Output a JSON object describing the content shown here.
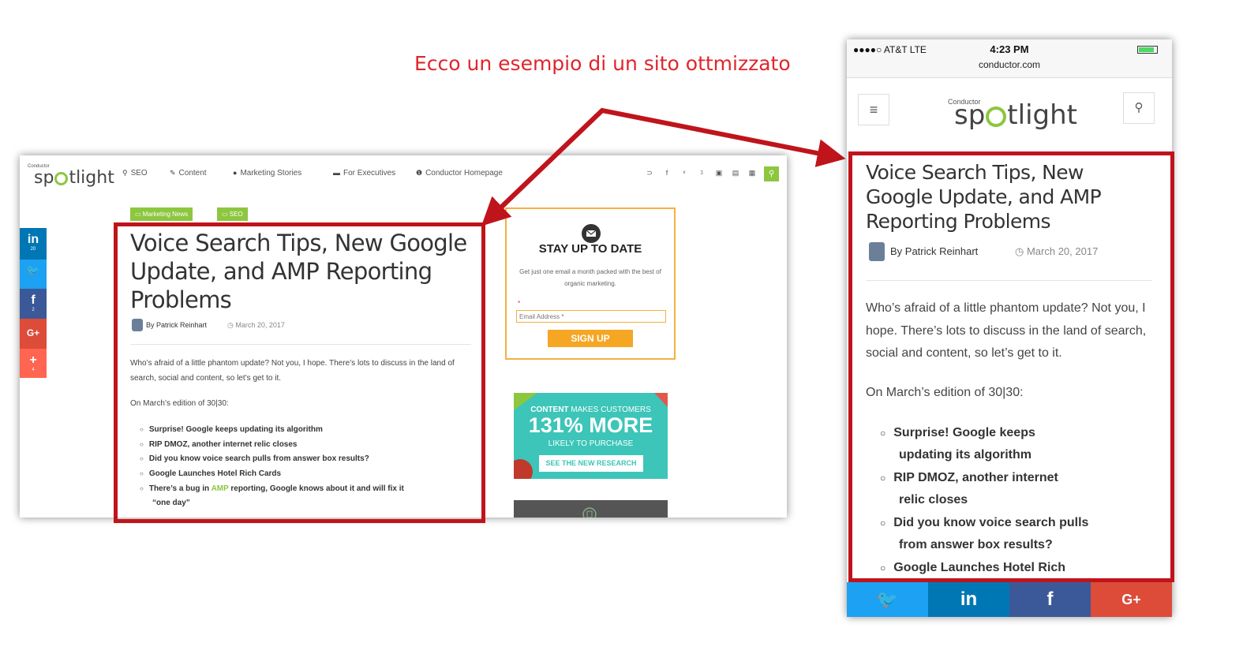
{
  "caption": "Ecco un esempio di un sito ottmizzato",
  "brand": {
    "small": "Conductor",
    "word_a": "sp",
    "word_b": "tlight"
  },
  "desktop": {
    "nav": [
      {
        "icon": "⚲",
        "label": "SEO"
      },
      {
        "icon": "✎",
        "label": "Content"
      },
      {
        "icon": "●",
        "label": "Marketing Stories"
      },
      {
        "icon": "▬",
        "label": "For Executives"
      },
      {
        "icon": "❶",
        "label": "Conductor Homepage"
      }
    ],
    "social_icons": [
      "rss-icon",
      "facebook-icon",
      "twitter-icon",
      "google-plus-icon",
      "instagram-icon",
      "youtube-icon",
      "linkedin-icon"
    ],
    "social_glyphs": [
      "⊃",
      "f",
      "ᵛ",
      "ᶾ",
      "▣",
      "▤",
      "▦"
    ],
    "search_glyph": "⚲",
    "tags": [
      "Marketing News",
      "SEO"
    ],
    "tag_icon": "▭",
    "title": "Voice Search Tips, New Google Update, and AMP Reporting Problems",
    "byline": "By Patrick Reinhart",
    "date": "March 20, 2017",
    "clock": "◷",
    "intro": "Who’s afraid of a little phantom update? Not you, I hope. There’s lots to discuss in the land of search, social and content, so let’s get to it.",
    "edition": "On March’s edition of 30|30:",
    "list": [
      "Surprise! Google keeps updating its algorithm",
      "RIP DMOZ, another internet relic closes",
      "Did you know voice search pulls from answer box results?",
      "Google Launches Hotel Rich Cards"
    ],
    "amp_item": {
      "before": "There’s a bug in ",
      "amp": "AMP",
      "after": " reporting, Google knows about it and will fix it",
      "line2": "“one day”"
    },
    "bullet": "○",
    "share": [
      {
        "glyph": "in",
        "count": "20",
        "color": "#0077b5"
      },
      {
        "glyph": "🐦",
        "count": "",
        "color": "#1da1f2"
      },
      {
        "glyph": "f",
        "count": "2",
        "color": "#3b5998"
      },
      {
        "glyph": "G+",
        "count": "",
        "color": "#dd4b39"
      },
      {
        "glyph": "+",
        "count": "4",
        "color": "#ff6550"
      }
    ],
    "newsletter": {
      "title": "STAY UP TO DATE",
      "text": "Get just one email a month packed with the best of organic marketing.",
      "required": "*",
      "placeholder": "Email Address *",
      "button": "SIGN UP"
    },
    "ad": {
      "line1a": "CONTENT",
      "line1b": " MAKES CUSTOMERS",
      "big": "131% MORE",
      "line2": "LIKELY TO PURCHASE",
      "cta": "SEE THE NEW RESEARCH"
    }
  },
  "phone": {
    "carrier": "●●●●○ AT&T  LTE",
    "time": "4:23 PM",
    "url": "conductor.com",
    "menu_glyph": "≡",
    "search_glyph": "⚲",
    "title": "Voice Search Tips, New Google Update, and AMP Reporting Problems",
    "byline": "By Patrick Reinhart",
    "clock": "◷",
    "date": "March 20, 2017",
    "intro": "Who’s afraid of a little phantom update? Not you, I hope. There’s lots to discuss in the land of search, social and content, so let’s get to it.",
    "edition": "On March’s edition of 30|30:",
    "list": [
      [
        "Surprise! Google keeps",
        "updating its algorithm"
      ],
      [
        "RIP DMOZ, another internet",
        "relic closes"
      ],
      [
        "Did you know voice search pulls",
        "from answer box results?"
      ],
      [
        "Google Launches Hotel Rich",
        ""
      ]
    ],
    "bullet": "○",
    "share": [
      {
        "glyph": "🐦",
        "color": "#1da1f2"
      },
      {
        "glyph": "in",
        "color": "#0077b5"
      },
      {
        "glyph": "f",
        "color": "#3b5998"
      },
      {
        "glyph": "G+",
        "color": "#dd4b39"
      }
    ]
  },
  "colors": {
    "accent_green": "#8dc63f",
    "highlight_red": "#c0141c",
    "caption_red": "#e0252b",
    "newsletter_orange": "#f5a623",
    "ad_teal": "#3cc5b8"
  }
}
